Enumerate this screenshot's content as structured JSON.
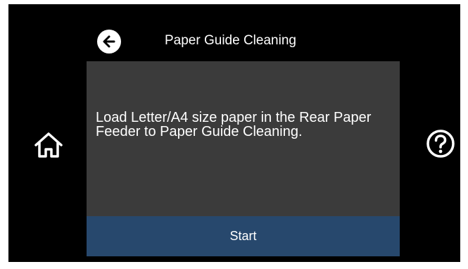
{
  "header": {
    "title": "Paper Guide Cleaning",
    "back_icon": "arrow-left-icon"
  },
  "side": {
    "home_icon": "home-icon",
    "help_icon": "question-circle-icon"
  },
  "dialog": {
    "message": "Load Letter/A4 size paper in the Rear Paper Feeder to Paper Guide Cleaning.",
    "start_label": "Start"
  },
  "colors": {
    "screen_bg": "#000000",
    "dialog_bg": "#3b3b3b",
    "start_bg": "#27486d",
    "text": "#ffffff"
  }
}
